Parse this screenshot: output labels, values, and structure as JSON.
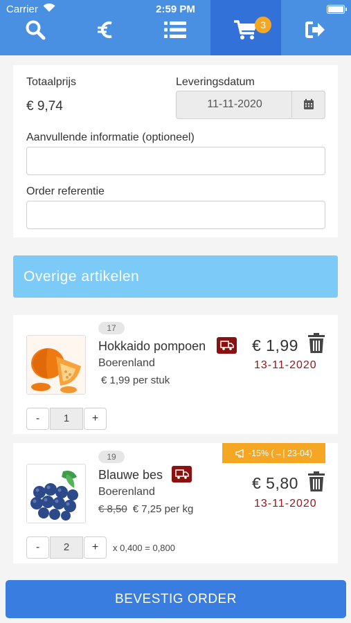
{
  "status_bar": {
    "carrier": "Carrier",
    "time": "2:59 PM"
  },
  "nav": {
    "items": [
      {
        "icon": "search-icon"
      },
      {
        "icon": "euro-icon"
      },
      {
        "icon": "list-icon"
      },
      {
        "icon": "cart-icon",
        "badge": "3",
        "active": true
      },
      {
        "icon": "sign-out-icon"
      }
    ]
  },
  "order": {
    "total_label": "Totaalprijs",
    "total_value": "€ 9,74",
    "delivery_label": "Leveringsdatum",
    "delivery_value": "11-11-2020",
    "info_label": "Aanvullende informatie (optioneel)",
    "info_value": "",
    "reference_label": "Order referentie",
    "reference_value": ""
  },
  "other_items_banner": "Overige artikelen",
  "products": [
    {
      "number": "17",
      "name": "Hokkaido pompoen",
      "supplier": "Boerenland",
      "old_price": "",
      "unit_price": "€ 1,99 per stuk",
      "price": "€ 1,99",
      "delivery_date": "13-11-2020",
      "quantity": "1",
      "calc": "",
      "promo": ""
    },
    {
      "number": "19",
      "name": "Blauwe bes",
      "supplier": "Boerenland",
      "old_price": "€ 8,50",
      "unit_price": "€ 7,25 per kg",
      "price": "€ 5,80",
      "delivery_date": "13-11-2020",
      "quantity": "2",
      "calc": "x 0,400 = 0,800",
      "promo": "-15% (→| 23-04)"
    }
  ],
  "stepper": {
    "minus": "-",
    "plus": "+"
  },
  "confirm_button": "BEVESTIG ORDER",
  "colors": {
    "header": "#4a90e2",
    "header_active": "#3272d8",
    "badge": "#f5a623",
    "banner": "#7ccaf8",
    "delivery_date": "#a11212",
    "truck": "#8b1010",
    "confirm": "#3a7de0"
  }
}
